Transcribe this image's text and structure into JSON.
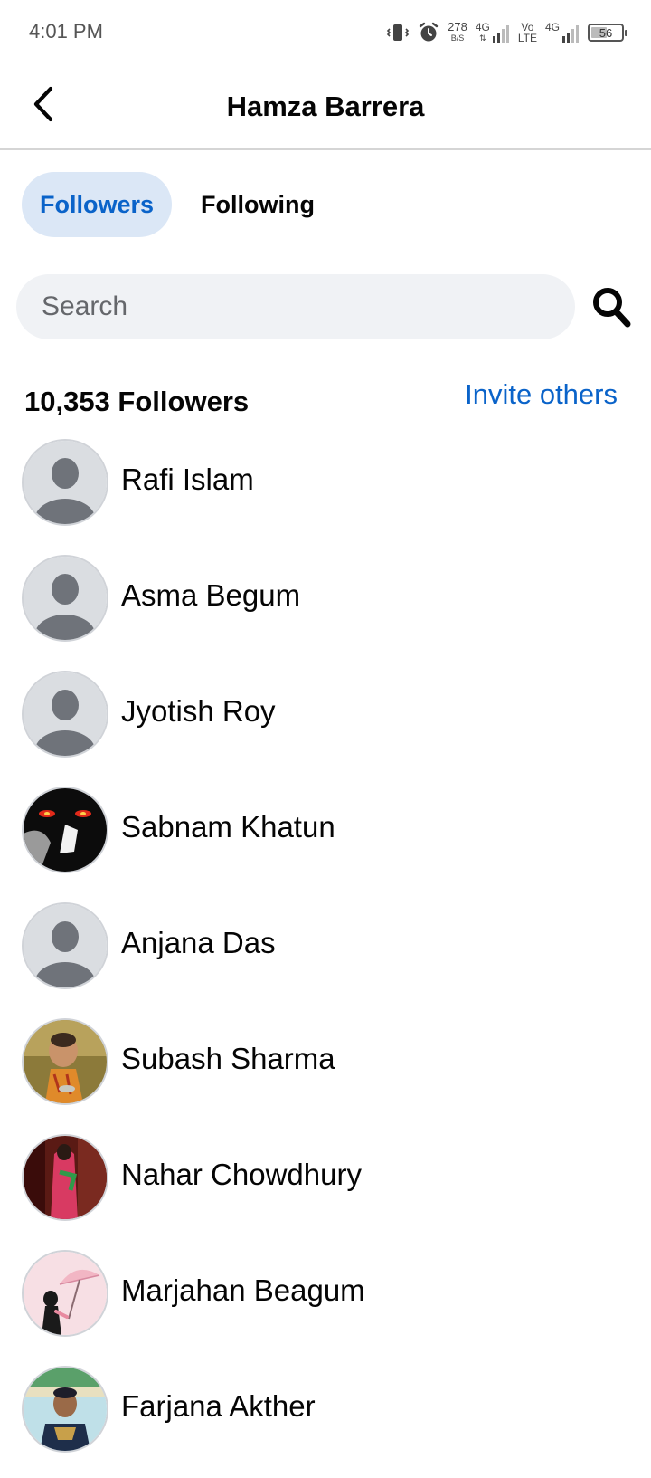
{
  "status_bar": {
    "time": "4:01 PM",
    "net_speed_value": "278",
    "net_speed_unit": "B/S",
    "network_1": "4G",
    "volte_top": "Vo",
    "volte_bottom": "LTE",
    "network_2": "4G",
    "battery": "56",
    "battery_level": 0.56
  },
  "header": {
    "title": "Hamza Barrera"
  },
  "tabs": [
    {
      "label": "Followers",
      "active": true
    },
    {
      "label": "Following",
      "active": false
    }
  ],
  "search": {
    "placeholder": "Search"
  },
  "section": {
    "count_label": "10,353 Followers",
    "invite_label": "Invite others"
  },
  "followers": [
    {
      "name": "Rafi Islam",
      "avatar": "default"
    },
    {
      "name": "Asma Begum",
      "avatar": "default"
    },
    {
      "name": "Jyotish Roy",
      "avatar": "default"
    },
    {
      "name": "Sabnam Khatun",
      "avatar": "dark-eyes"
    },
    {
      "name": "Anjana Das",
      "avatar": "default"
    },
    {
      "name": "Subash Sharma",
      "avatar": "child-photo"
    },
    {
      "name": "Nahar Chowdhury",
      "avatar": "red-dress-photo"
    },
    {
      "name": "Marjahan Beagum",
      "avatar": "umbrella-illustration"
    },
    {
      "name": "Farjana Akther",
      "avatar": "boy-photo"
    }
  ],
  "colors": {
    "accent": "#0a63c9",
    "active_tab_bg": "#dbe7f6",
    "search_bg": "#f0f2f5",
    "divider": "#d5d5d5"
  }
}
